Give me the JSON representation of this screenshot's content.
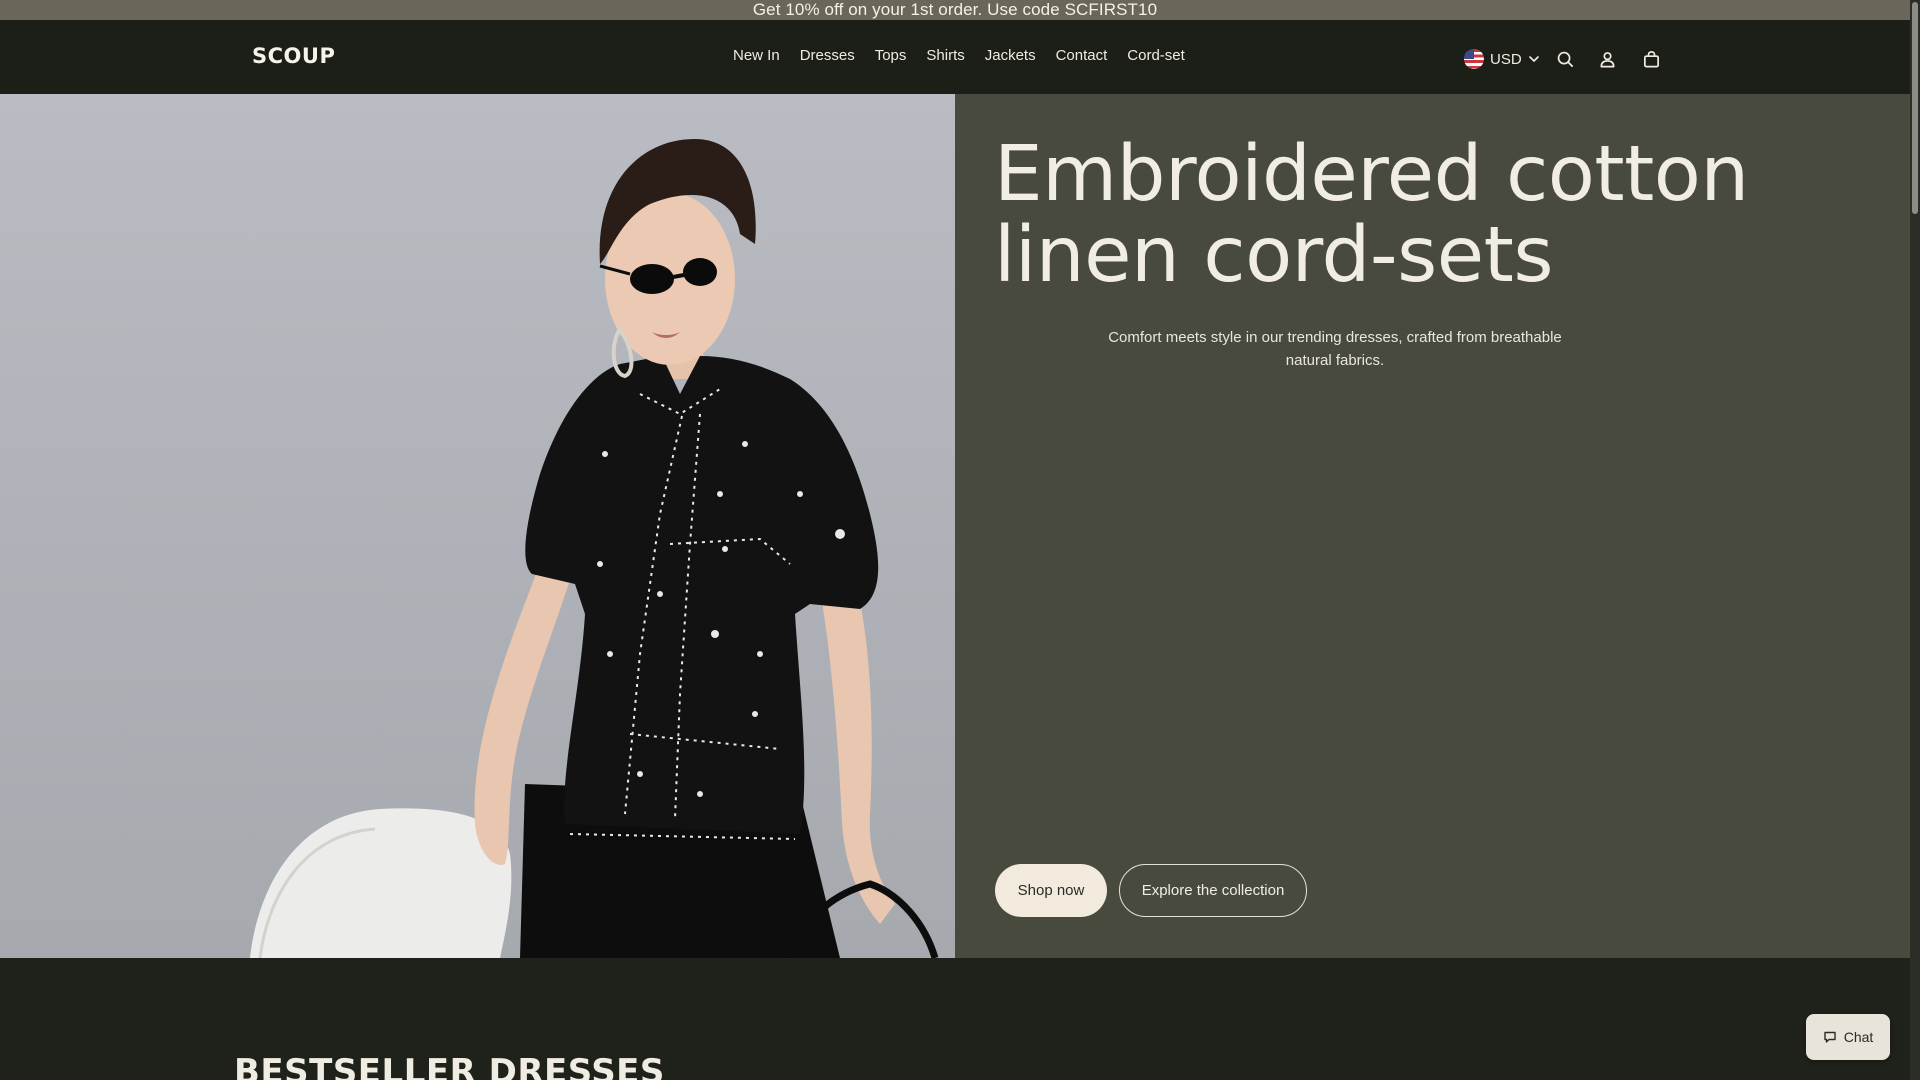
{
  "announcement": {
    "text": "Get 10% off on your 1st order. Use code SCFIRST10"
  },
  "header": {
    "logo": "SCOUP",
    "nav": [
      "New In",
      "Dresses",
      "Tops",
      "Shirts",
      "Jackets",
      "Contact",
      "Cord-set"
    ],
    "currency": "USD",
    "icons": [
      "us-flag-icon",
      "chevron-down-icon",
      "search-icon",
      "account-icon",
      "cart-icon"
    ]
  },
  "hero": {
    "title": "Embroidered cotton linen cord-sets",
    "subtitle": "Comfort meets style in our trending dresses, crafted from breathable natural fabrics.",
    "primary_button": "Shop now",
    "secondary_button": "Explore the collection"
  },
  "bestseller": {
    "title": "BESTSELLER DRESSES"
  },
  "chat": {
    "label": "Chat",
    "icon": "chat-bubble-icon"
  },
  "colors": {
    "announcement_bg": "#6b665a",
    "header_bg": "#1c1e18",
    "hero_panel_bg": "#474a3d",
    "page_bg": "#1f211b",
    "text_light": "#f2ede3",
    "button_light": "#f2ebdd"
  }
}
